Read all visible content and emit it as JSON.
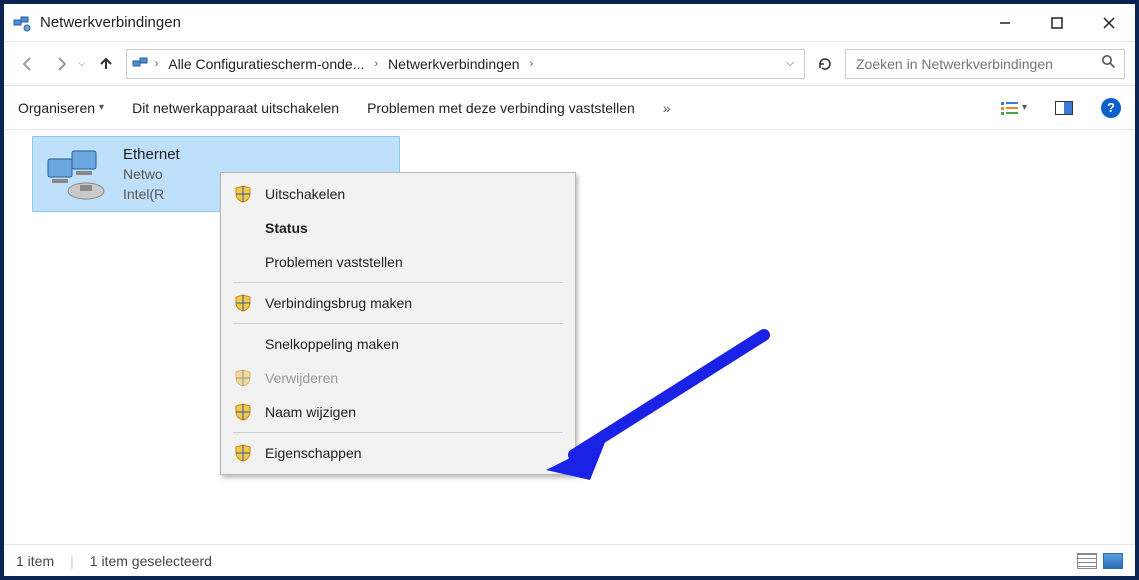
{
  "window": {
    "title": "Netwerkverbindingen"
  },
  "breadcrumbs": {
    "level1": "Alle Configuratiescherm-onde...",
    "level2": "Netwerkverbindingen"
  },
  "search": {
    "placeholder": "Zoeken in Netwerkverbindingen"
  },
  "toolbar": {
    "organize": "Organiseren",
    "disable_device": "Dit netwerkapparaat uitschakelen",
    "diagnose": "Problemen met deze verbinding vaststellen",
    "overflow": "»"
  },
  "connection": {
    "name": "Ethernet",
    "line2": "Netwo",
    "line3": "Intel(R"
  },
  "context_menu": {
    "disable": "Uitschakelen",
    "status": "Status",
    "diagnose": "Problemen vaststellen",
    "bridge": "Verbindingsbrug maken",
    "shortcut": "Snelkoppeling maken",
    "delete": "Verwijderen",
    "rename": "Naam wijzigen",
    "properties": "Eigenschappen"
  },
  "statusbar": {
    "count": "1 item",
    "selected": "1 item geselecteerd"
  }
}
